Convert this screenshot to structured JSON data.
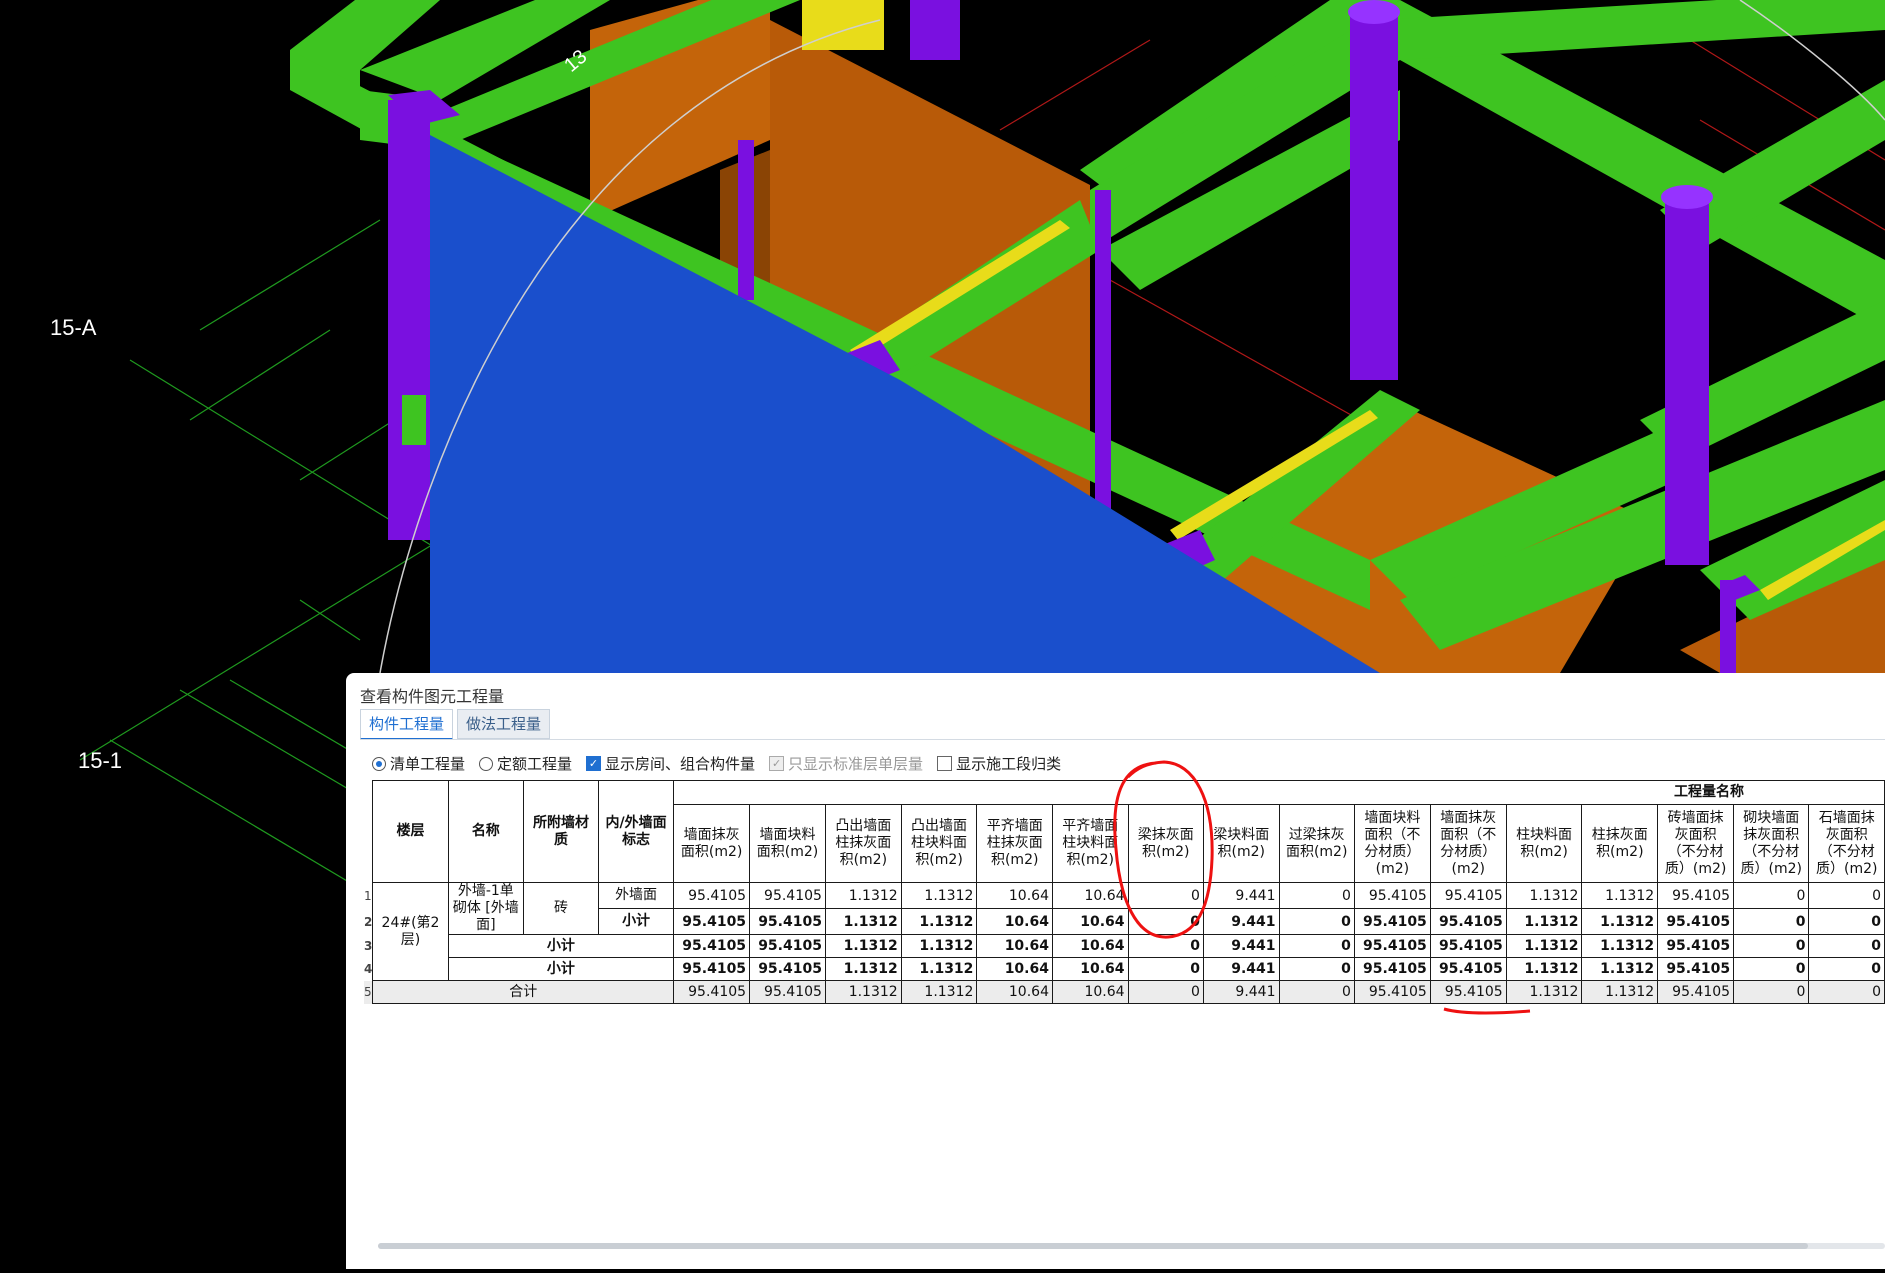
{
  "viewport": {
    "axis_labels": [
      "15-A",
      "15-1",
      "13"
    ]
  },
  "panel": {
    "title": "查看构件图元工程量",
    "tabs": [
      {
        "label": "构件工程量",
        "active": true
      },
      {
        "label": "做法工程量",
        "active": false
      }
    ],
    "options": {
      "radio_qd": "清单工程量",
      "radio_de": "定额工程量",
      "cb_room": "显示房间、组合构件量",
      "cb_std": "只显示标准层单层量",
      "cb_stage": "显示施工段归类"
    },
    "table": {
      "group_header": "工程量名称",
      "fixed_headers": [
        "楼层",
        "名称",
        "所附墙材质",
        "内/外墙面标志"
      ],
      "metric_headers": [
        "墙面抹灰面积(m2)",
        "墙面块料面积(m2)",
        "凸出墙面柱抹灰面积(m2)",
        "凸出墙面柱块料面积(m2)",
        "平齐墙面柱抹灰面积(m2)",
        "平齐墙面柱块料面积(m2)",
        "梁抹灰面积(m2)",
        "梁块料面积(m2)",
        "过梁抹灰面积(m2)",
        "墙面块料面积（不分材质）(m2)",
        "墙面抹灰面积（不分材质）(m2)",
        "柱块料面积(m2)",
        "柱抹灰面积(m2)",
        "砖墙面抹灰面积（不分材质）(m2)",
        "砌块墙面抹灰面积（不分材质）(m2)",
        "石墙面抹灰面积（不分材质）(m2)"
      ],
      "row_numbers": [
        "1",
        "2",
        "3",
        "4",
        "5"
      ],
      "floor": "24#(第2层)",
      "name": "外墙-1单砌体 [外墙面]",
      "material": "砖",
      "side": "外墙面",
      "subtotal": "小计",
      "total": "合计",
      "values": [
        "95.4105",
        "95.4105",
        "1.1312",
        "1.1312",
        "10.64",
        "10.64",
        "0",
        "9.441",
        "0",
        "95.4105",
        "95.4105",
        "1.1312",
        "1.1312",
        "95.4105",
        "0",
        "0"
      ]
    }
  }
}
